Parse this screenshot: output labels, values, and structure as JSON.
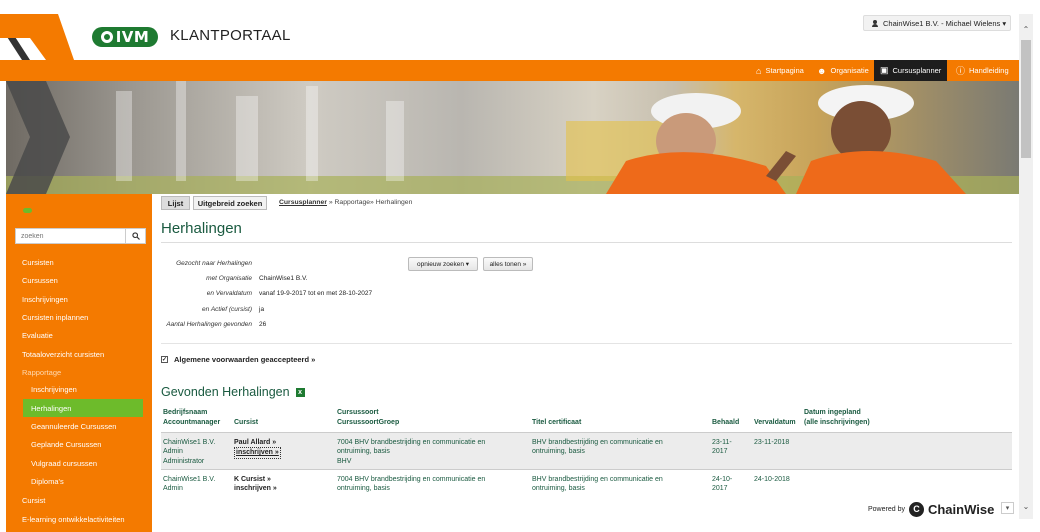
{
  "header": {
    "logo_text": "IVM",
    "portal_title": "KLANTPORTAAL",
    "user_menu": "ChainWise1 B.V. - Michael Wielens ▾"
  },
  "topnav": [
    {
      "label": "Startpagina",
      "icon": "home-icon"
    },
    {
      "label": "Organisatie",
      "icon": "people-icon"
    },
    {
      "label": "Cursusplanner",
      "icon": "calendar-icon",
      "active": true
    },
    {
      "label": "Handleiding",
      "icon": "help-icon"
    }
  ],
  "sidebar": {
    "search_placeholder": "zoeken",
    "items": [
      {
        "label": "Cursisten"
      },
      {
        "label": "Cursussen"
      },
      {
        "label": "Inschrijvingen"
      },
      {
        "label": "Cursisten inplannen"
      },
      {
        "label": "Evaluatie"
      },
      {
        "label": "Totaaloverzicht cursisten"
      },
      {
        "label": "Rapportage"
      },
      {
        "label": "Inschrijvingen"
      },
      {
        "label": "Herhalingen"
      },
      {
        "label": "Geannuleerde Cursussen"
      },
      {
        "label": "Geplande Cursussen"
      },
      {
        "label": "Vulgraad cursussen"
      },
      {
        "label": "Diploma's"
      },
      {
        "label": "Cursist"
      },
      {
        "label": "E-learning ontwikkelactiviteiten"
      }
    ]
  },
  "main": {
    "tabs": [
      "Lijst",
      "Uitgebreid zoeken"
    ],
    "breadcrumb": {
      "link": "Cursusplanner",
      "rest": " » Rapportage» Herhalingen"
    },
    "title": "Herhalingen",
    "criteria": [
      {
        "label": "Gezocht naar Herhalingen",
        "value": ""
      },
      {
        "label": "met Organisatie",
        "value": "ChainWise1 B.V."
      },
      {
        "label": "en Vervaldatum",
        "value": "vanaf 19-9-2017 tot en met 28-10-2027"
      },
      {
        "label": "en Actief (cursist)",
        "value": "ja"
      },
      {
        "label": "Aantal Herhalingen gevonden",
        "value": "26"
      }
    ],
    "buttons": {
      "reset": "opnieuw zoeken ▾",
      "show_all": "alles tonen »"
    },
    "terms": "Algemene voorwaarden geaccepteerd  »",
    "results_title": "Gevonden Herhalingen",
    "columns": {
      "bedrijf": "Bedrijfsnaam",
      "accountmanager": "Accountmanager",
      "cursist": "Cursist",
      "cursussoort": "Cursussoort",
      "cursussoortgroep": "CursussoortGroep",
      "titel": "Titel certificaat",
      "behaald": "Behaald",
      "vervaldatum": "Vervaldatum",
      "datum_ingepland": "Datum ingepland",
      "alle_inschrijvingen": "(alle inschrijvingen)"
    },
    "rows": [
      {
        "bedrijf": "ChainWise1 B.V.",
        "accountmanager_1": "Admin",
        "accountmanager_2": "Administrator",
        "cursist": "Paul Allard »",
        "inschrijven": "inschrijven »",
        "cursussoort_1": "7004 BHV brandbestrijding en communicatie en",
        "cursussoort_2": "ontruiming, basis",
        "groep": "BHV",
        "titel_1": "BHV brandbestrijding en communicatie en",
        "titel_2": "ontruiming, basis",
        "behaald_1": "23-11-",
        "behaald_2": "2017",
        "vervaldatum": "23-11-2018"
      },
      {
        "bedrijf": "ChainWise1 B.V.",
        "accountmanager_1": "Admin",
        "cursist": "K Cursist »",
        "inschrijven": "inschrijven »",
        "cursussoort_1": "7004 BHV brandbestrijding en communicatie en",
        "cursussoort_2": "ontruiming, basis",
        "titel_1": "BHV brandbestrijding en communicatie en",
        "titel_2": "ontruiming, basis",
        "behaald_1": "24-10-",
        "behaald_2": "2017",
        "vervaldatum": "24-10-2018"
      }
    ]
  },
  "footer": {
    "powered_by": "Powered by",
    "brand": "ChainWise"
  },
  "colors": {
    "accent": "#f47a00",
    "green": "#1a5a40",
    "active_side": "#6dbb2b",
    "dark_nav": "#1d1d1d"
  }
}
